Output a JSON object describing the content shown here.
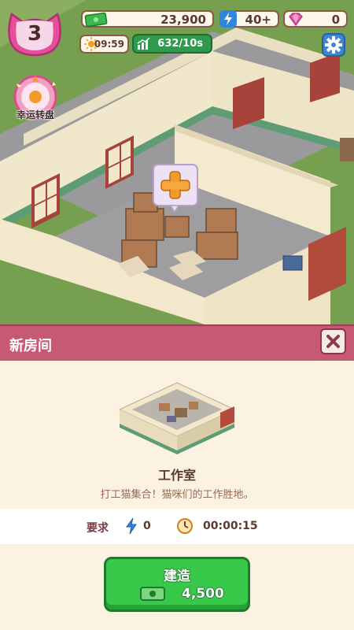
{
  "hud": {
    "level": "3",
    "cash": "23,900",
    "energy": "40+",
    "gems": "0",
    "clock": "09:59",
    "income_rate": "632/10s"
  },
  "lucky_wheel": {
    "label": "幸运转盘"
  },
  "panel": {
    "title": "新房间",
    "room_name": "工作室",
    "room_description": "打工猫集合！猫咪们的工作胜地。",
    "requirements": {
      "label": "要求",
      "energy_cost": "0",
      "build_time": "00:00:15"
    },
    "build_button": {
      "label": "建造",
      "cost": "4,500"
    }
  },
  "colors": {
    "header_pink": "#c65a72",
    "build_green": "#38c94a",
    "cash_green": "#3db84a",
    "energy_blue": "#2f86e0",
    "gem_pink": "#e05aa8"
  },
  "icons": [
    "cash-icon",
    "lightning-icon",
    "gem-icon",
    "sun-icon",
    "income-chart-icon",
    "gear-icon",
    "lucky-wheel-icon",
    "plus-icon",
    "close-icon",
    "clock-icon"
  ]
}
